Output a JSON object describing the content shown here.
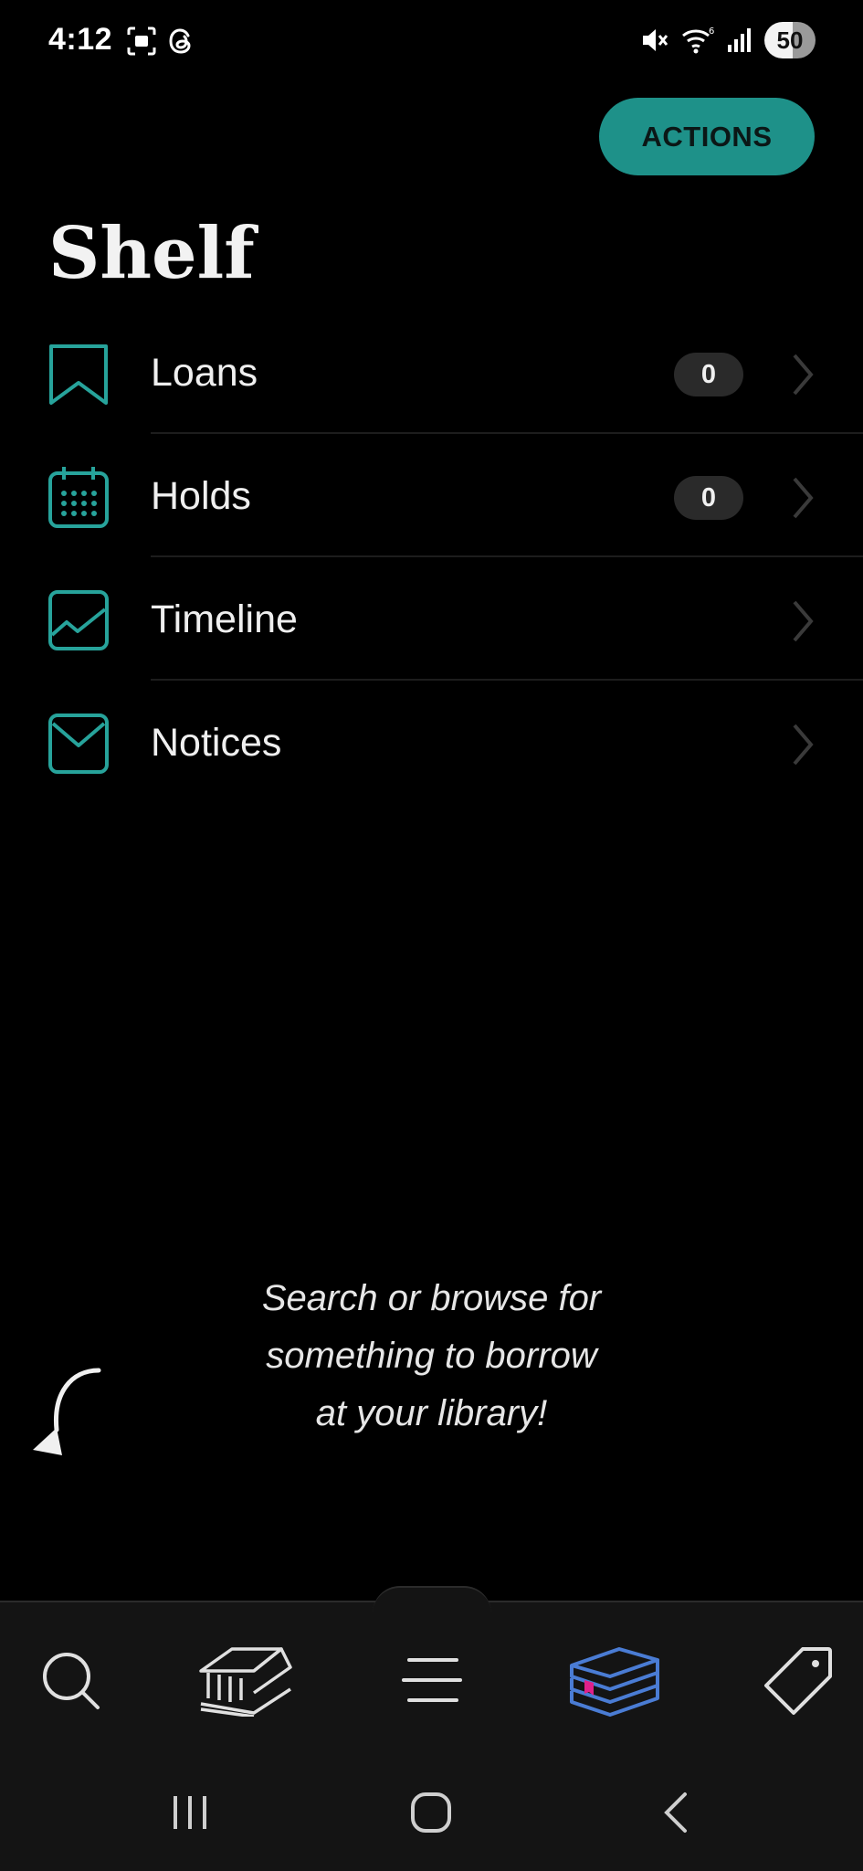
{
  "status_bar": {
    "time": "4:12",
    "battery": "50"
  },
  "header": {
    "actions_label": "ACTIONS",
    "title": "Shelf"
  },
  "shelf": {
    "items": [
      {
        "label": "Loans",
        "count": "0",
        "icon": "bookmark-icon"
      },
      {
        "label": "Holds",
        "count": "0",
        "icon": "calendar-icon"
      },
      {
        "label": "Timeline",
        "icon": "chart-icon"
      },
      {
        "label": "Notices",
        "icon": "envelope-icon"
      }
    ]
  },
  "empty_state": {
    "lines": [
      "Search or browse for",
      "something to borrow",
      "at your library!"
    ]
  },
  "bottom_nav": {
    "items": [
      "search-icon",
      "library-icon",
      "menu-icon",
      "shelf-books-icon",
      "tag-icon"
    ],
    "active": "shelf-books-icon"
  },
  "colors": {
    "accent": "#1e9189",
    "icon_teal": "#27a39b",
    "active_nav": "#4a7cd4",
    "bookmark_pink": "#e0208a",
    "background": "#000000",
    "nav_background": "#141414"
  }
}
